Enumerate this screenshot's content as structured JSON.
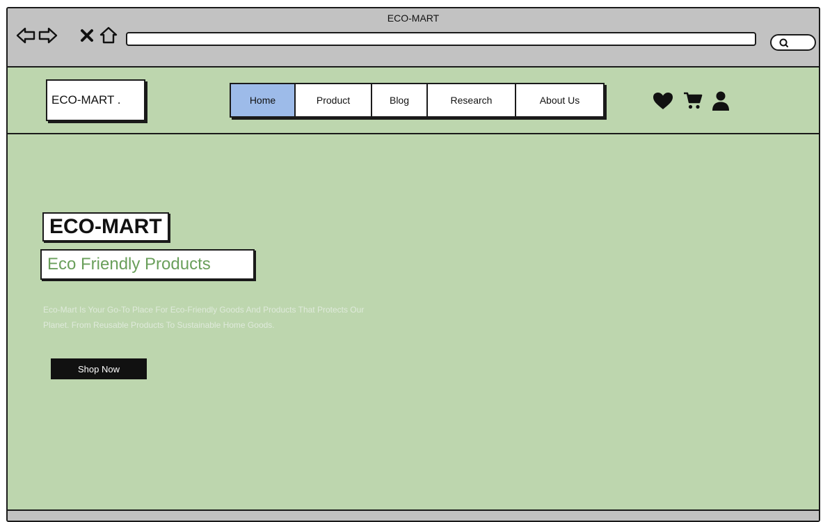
{
  "window": {
    "title": "ECO-MART"
  },
  "browser": {
    "back_icon": "arrow-left-icon",
    "forward_icon": "arrow-right-icon",
    "close_icon": "close-icon",
    "home_icon": "home-icon",
    "search_icon": "search-icon"
  },
  "header": {
    "logo_text": "ECO-MART .",
    "nav": [
      {
        "label": "Home",
        "active": true
      },
      {
        "label": "Product",
        "active": false
      },
      {
        "label": "Blog",
        "active": false
      },
      {
        "label": "Research",
        "active": false
      },
      {
        "label": "About Us",
        "active": false
      }
    ],
    "icons": [
      "heart-icon",
      "cart-icon",
      "user-icon"
    ]
  },
  "hero": {
    "title": "ECO-MART",
    "subtitle": "Eco Friendly Products",
    "description": "Eco-Mart Is Your Go-To Place For Eco-Friendly Goods And Products That Protects Our Planet. From Reusable Products To Sustainable Home Goods.",
    "cta_label": "Shop Now"
  },
  "colors": {
    "page_bg": "#bdd6ae",
    "chrome": "#c2c2c2",
    "active_tab": "#9dbbe9",
    "subtitle_text": "#6a9f5b",
    "button_bg": "#111111"
  }
}
